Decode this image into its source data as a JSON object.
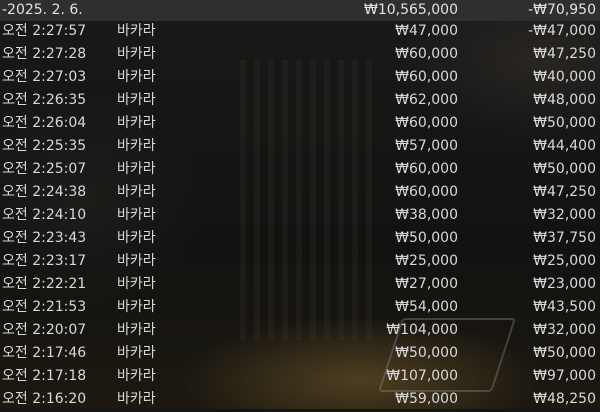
{
  "header": {
    "date": "-2025. 2. 6.",
    "total_bet": "₩10,565,000",
    "total_result": "-₩70,950"
  },
  "rows": [
    {
      "time": "오전 2:27:57",
      "game": "바카라",
      "bet": "₩47,000",
      "result": "-₩47,000"
    },
    {
      "time": "오전 2:27:28",
      "game": "바카라",
      "bet": "₩60,000",
      "result": "₩47,250"
    },
    {
      "time": "오전 2:27:03",
      "game": "바카라",
      "bet": "₩60,000",
      "result": "₩40,000"
    },
    {
      "time": "오전 2:26:35",
      "game": "바카라",
      "bet": "₩62,000",
      "result": "₩48,000"
    },
    {
      "time": "오전 2:26:04",
      "game": "바카라",
      "bet": "₩60,000",
      "result": "₩50,000"
    },
    {
      "time": "오전 2:25:35",
      "game": "바카라",
      "bet": "₩57,000",
      "result": "₩44,400"
    },
    {
      "time": "오전 2:25:07",
      "game": "바카라",
      "bet": "₩60,000",
      "result": "₩50,000"
    },
    {
      "time": "오전 2:24:38",
      "game": "바카라",
      "bet": "₩60,000",
      "result": "₩47,250"
    },
    {
      "time": "오전 2:24:10",
      "game": "바카라",
      "bet": "₩38,000",
      "result": "₩32,000"
    },
    {
      "time": "오전 2:23:43",
      "game": "바카라",
      "bet": "₩50,000",
      "result": "₩37,750"
    },
    {
      "time": "오전 2:23:17",
      "game": "바카라",
      "bet": "₩25,000",
      "result": "₩25,000"
    },
    {
      "time": "오전 2:22:21",
      "game": "바카라",
      "bet": "₩27,000",
      "result": "₩23,000"
    },
    {
      "time": "오전 2:21:53",
      "game": "바카라",
      "bet": "₩54,000",
      "result": "₩43,500"
    },
    {
      "time": "오전 2:20:07",
      "game": "바카라",
      "bet": "₩104,000",
      "result": "₩32,000"
    },
    {
      "time": "오전 2:17:46",
      "game": "바카라",
      "bet": "₩50,000",
      "result": "₩50,000"
    },
    {
      "time": "오전 2:17:18",
      "game": "바카라",
      "bet": "₩107,000",
      "result": "₩97,000"
    },
    {
      "time": "오전 2:16:20",
      "game": "바카라",
      "bet": "₩59,000",
      "result": "₩48,250"
    }
  ],
  "colors": {
    "header_bg": "#2f2f2f",
    "text": "#d8d8d8"
  }
}
